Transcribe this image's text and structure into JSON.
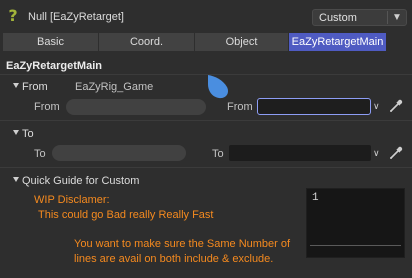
{
  "header": {
    "title": "Null [EaZyRetarget]",
    "mode_value": "Custom",
    "help_icon": "question-mark-icon"
  },
  "tabs": [
    {
      "label": "Basic",
      "active": false
    },
    {
      "label": "Coord.",
      "active": false
    },
    {
      "label": "Object",
      "active": false
    },
    {
      "label": "EaZyRetargetMain",
      "active": true
    }
  ],
  "section_title": "EaZyRetargetMain",
  "from_group": {
    "title": "From",
    "preset": "EaZyRig_Game",
    "left_label": "From",
    "left_value": "",
    "right_label": "From",
    "right_value": ""
  },
  "to_group": {
    "title": "To",
    "left_label": "To",
    "left_value": "",
    "right_label": "To",
    "right_value": ""
  },
  "guide": {
    "title": "Quick Guide for Custom",
    "disclaimer_title": "WIP Disclamer:",
    "disclaimer_text": "This could go Bad really Really Fast",
    "info_line1": "You want to make sure the Same Number of",
    "info_line2": "lines are avail on both include & exclude.",
    "editor_line_number": "1"
  },
  "colors": {
    "accent_tab": "#4f5bc2",
    "guide_text": "#f58a1f",
    "focus_border": "#8d9df5",
    "help_icon": "#a3b43a",
    "cursor_blob": "#4a8ee0"
  }
}
